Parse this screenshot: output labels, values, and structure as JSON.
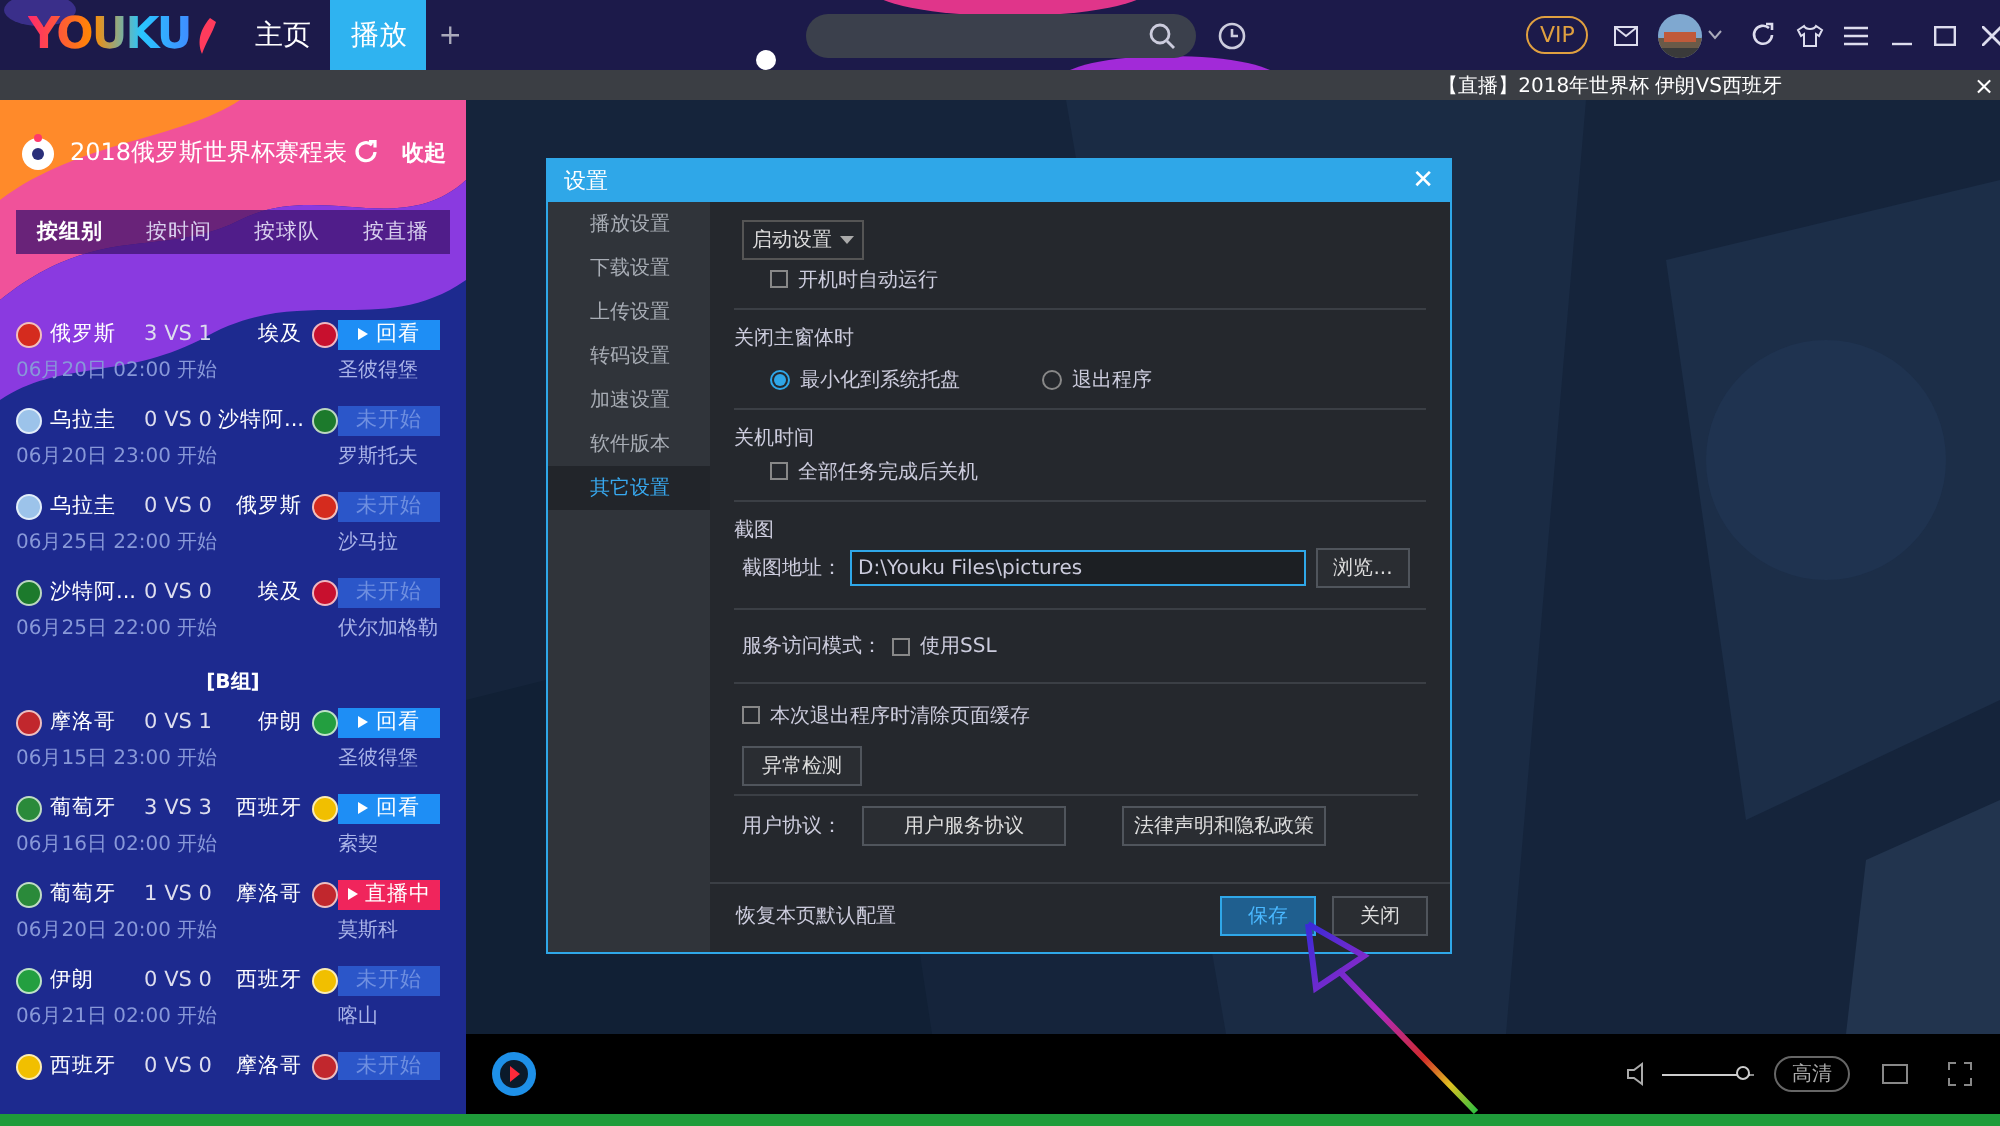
{
  "top_bar": {
    "logo": "YOUKU",
    "nav": [
      {
        "label": "主页",
        "selected": false
      },
      {
        "label": "播放",
        "selected": true
      }
    ],
    "add_tab": "+",
    "vip": "VIP"
  },
  "live_banner": {
    "text": "【直播】2018年世界杯 伊朗VS西班牙",
    "close": "×"
  },
  "sidebar": {
    "title": "2018俄罗斯世界杯赛程表",
    "collapse": "收起",
    "tabs": [
      {
        "label": "按组别",
        "selected": true
      },
      {
        "label": "按时间",
        "selected": false
      },
      {
        "label": "按球队",
        "selected": false
      },
      {
        "label": "按直播",
        "selected": false
      }
    ],
    "items": [
      {
        "kind": "match",
        "home": {
          "name": "俄罗斯",
          "color": "#d52b1e"
        },
        "score": "3 VS 1",
        "away": {
          "name": "埃及",
          "color": "#c8102e"
        },
        "time": "06月20日 02:00 开始",
        "venue": "圣彼得堡",
        "status": {
          "kind": "replay",
          "label": "回看"
        }
      },
      {
        "kind": "match",
        "home": {
          "name": "乌拉圭",
          "color": "#9cc3ea"
        },
        "score": "0 VS 0",
        "away": {
          "name": "沙特阿...",
          "color": "#1c7a2c"
        },
        "time": "06月20日 23:00 开始",
        "venue": "罗斯托夫",
        "status": {
          "kind": "upcoming",
          "label": "未开始"
        }
      },
      {
        "kind": "match",
        "home": {
          "name": "乌拉圭",
          "color": "#9cc3ea"
        },
        "score": "0 VS 0",
        "away": {
          "name": "俄罗斯",
          "color": "#d52b1e"
        },
        "time": "06月25日 22:00 开始",
        "venue": "沙马拉",
        "status": {
          "kind": "upcoming",
          "label": "未开始"
        }
      },
      {
        "kind": "match",
        "home": {
          "name": "沙特阿...",
          "color": "#1c7a2c"
        },
        "score": "0 VS 0",
        "away": {
          "name": "埃及",
          "color": "#c8102e"
        },
        "time": "06月25日 22:00 开始",
        "venue": "伏尔加格勒",
        "status": {
          "kind": "upcoming",
          "label": "未开始"
        }
      },
      {
        "kind": "group",
        "label": "[B组]"
      },
      {
        "kind": "match",
        "home": {
          "name": "摩洛哥",
          "color": "#c1272d"
        },
        "score": "0 VS 1",
        "away": {
          "name": "伊朗",
          "color": "#239f40"
        },
        "time": "06月15日 23:00 开始",
        "venue": "圣彼得堡",
        "status": {
          "kind": "replay",
          "label": "回看"
        }
      },
      {
        "kind": "match",
        "home": {
          "name": "葡萄牙",
          "color": "#2a8a3a"
        },
        "score": "3 VS 3",
        "away": {
          "name": "西班牙",
          "color": "#f1bf00"
        },
        "time": "06月16日 02:00 开始",
        "venue": "索契",
        "status": {
          "kind": "replay",
          "label": "回看"
        }
      },
      {
        "kind": "match",
        "home": {
          "name": "葡萄牙",
          "color": "#2a8a3a"
        },
        "score": "1 VS 0",
        "away": {
          "name": "摩洛哥",
          "color": "#c1272d"
        },
        "time": "06月20日 20:00 开始",
        "venue": "莫斯科",
        "status": {
          "kind": "live",
          "label": "直播中"
        }
      },
      {
        "kind": "match",
        "home": {
          "name": "伊朗",
          "color": "#239f40"
        },
        "score": "0 VS 0",
        "away": {
          "name": "西班牙",
          "color": "#f1bf00"
        },
        "time": "06月21日 02:00 开始",
        "venue": "喀山",
        "status": {
          "kind": "upcoming",
          "label": "未开始"
        }
      },
      {
        "kind": "match",
        "home": {
          "name": "西班牙",
          "color": "#f1bf00"
        },
        "score": "0 VS 0",
        "away": {
          "name": "摩洛哥",
          "color": "#c1272d"
        },
        "status": {
          "kind": "upcoming",
          "label": "未开始"
        }
      }
    ]
  },
  "dialog": {
    "title": "设置",
    "close": "✕",
    "nav": [
      {
        "label": "播放设置",
        "selected": false
      },
      {
        "label": "下载设置",
        "selected": false
      },
      {
        "label": "上传设置",
        "selected": false
      },
      {
        "label": "转码设置",
        "selected": false
      },
      {
        "label": "加速设置",
        "selected": false
      },
      {
        "label": "软件版本",
        "selected": false
      },
      {
        "label": "其它设置",
        "selected": true
      }
    ],
    "startup_dropdown": "启动设置",
    "auto_start": {
      "label": "开机时自动运行",
      "checked": false
    },
    "close_section": {
      "title": "关闭主窗体时",
      "options": [
        {
          "label": "最小化到系统托盘",
          "selected": true
        },
        {
          "label": "退出程序",
          "selected": false
        }
      ]
    },
    "shutdown": {
      "title": "关机时间",
      "option": {
        "label": "全部任务完成后关机",
        "checked": false
      }
    },
    "screenshot": {
      "title": "截图",
      "path_label": "截图地址：",
      "path": "D:\\Youku Files\\pictures",
      "browse": "浏览..."
    },
    "service": {
      "label": "服务访问模式：",
      "ssl": {
        "label": "使用SSL",
        "checked": false
      }
    },
    "clear_cache": {
      "label": "本次退出程序时清除页面缓存",
      "checked": false
    },
    "diagnose": "异常检测",
    "agreement": {
      "label": "用户协议：",
      "buttons": [
        "用户服务协议",
        "法律声明和隐私政策"
      ]
    },
    "footer": {
      "restore": "恢复本页默认配置",
      "buttons": [
        {
          "label": "保存",
          "kind": "primary"
        },
        {
          "label": "关闭",
          "kind": "normal"
        }
      ]
    }
  },
  "player": {
    "quality": "高清",
    "volume": {
      "level": 0.95
    }
  }
}
